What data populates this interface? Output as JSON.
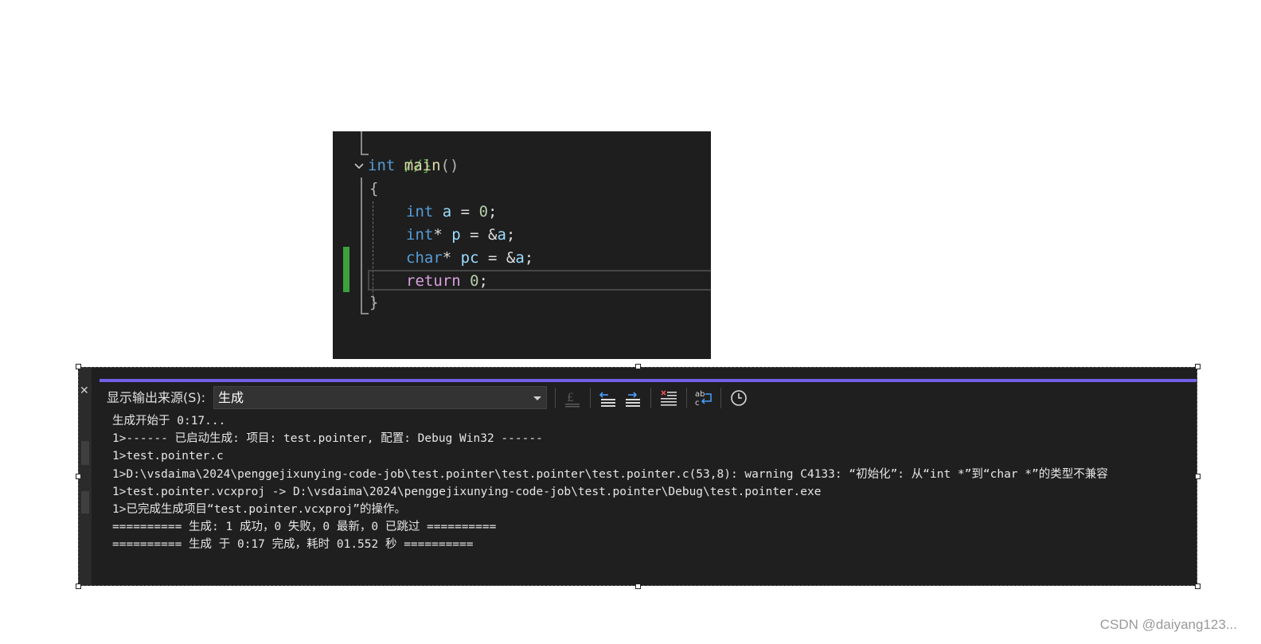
{
  "editor": {
    "lines": {
      "comment_close": "//}",
      "main_kw": "int",
      "main_fn": "main",
      "main_parens": "()",
      "open_brace": "{",
      "l1_type": "int",
      "l1_var": "a",
      "l1_op": " = ",
      "l1_val": "0",
      "l1_end": ";",
      "l2_type": "int",
      "l2_star": "*",
      "l2_var": "p",
      "l2_op": " = &",
      "l2_ref": "a",
      "l2_end": ";",
      "l3_type": "char",
      "l3_star": "*",
      "l3_var": "pc",
      "l3_op": " = &",
      "l3_ref": "a",
      "l3_end": ";",
      "l4_kw": "return",
      "l4_val": "0",
      "l4_end": ";",
      "close_brace": "}"
    }
  },
  "output_panel": {
    "source_label": "显示输出来源(S):",
    "source_selected": "生成",
    "toolbar_icons": [
      "find-message-icon",
      "prev-message-icon",
      "next-message-icon",
      "clear-all-icon",
      "toggle-word-wrap-icon",
      "timestamp-icon"
    ],
    "lines": [
      "生成开始于 0:17...",
      "1>------ 已启动生成: 项目: test.pointer, 配置: Debug Win32 ------",
      "1>test.pointer.c",
      "1>D:\\vsdaima\\2024\\penggejixunying-code-job\\test.pointer\\test.pointer\\test.pointer.c(53,8): warning C4133: “初始化”: 从“int *”到“char *”的类型不兼容",
      "1>test.pointer.vcxproj -> D:\\vsdaima\\2024\\penggejixunying-code-job\\test.pointer\\Debug\\test.pointer.exe",
      "1>已完成生成项目“test.pointer.vcxproj”的操作。",
      "========== 生成: 1 成功，0 失败，0 最新，0 已跳过 ==========",
      "========== 生成 于 0:17 完成，耗时 01.552 秒 =========="
    ]
  },
  "colors": {
    "accent_purple": "#7160e8",
    "change_marker_green": "#3ca03c",
    "panel_background": "#1f1f1f",
    "editor_background": "#1e1e1e"
  },
  "watermark": "CSDN @daiyang123..."
}
